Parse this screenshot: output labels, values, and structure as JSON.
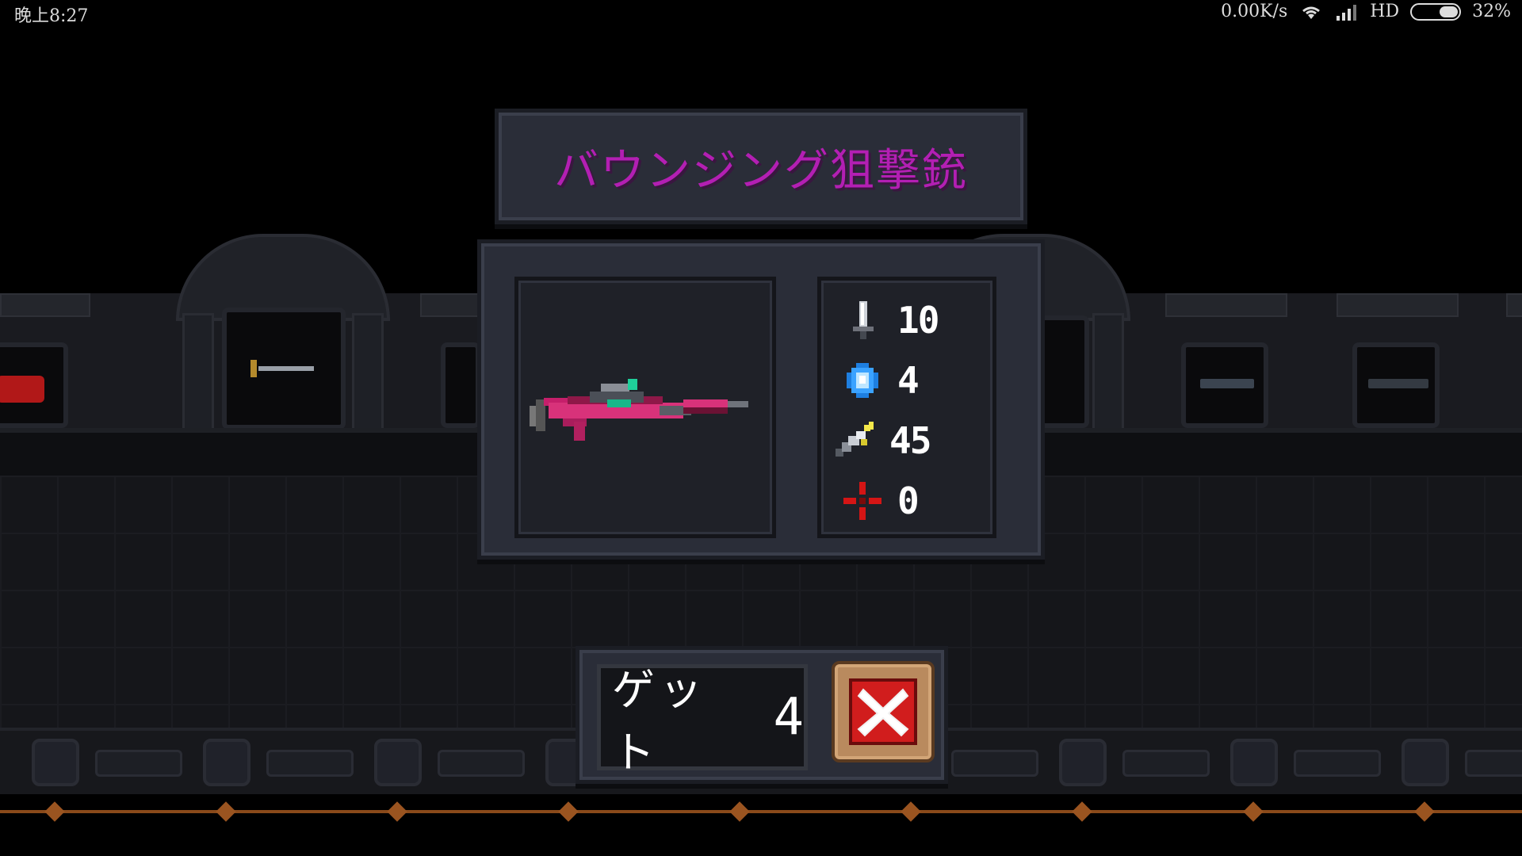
{
  "status_bar": {
    "time": "晚上8:27",
    "network_speed": "0.00K/s",
    "network_type": "HD",
    "battery": "32%"
  },
  "dialog": {
    "weapon_name": "バウンジング狙撃銃",
    "weapon_name_color": "#b31fb3",
    "stats": [
      {
        "icon": "sword-icon",
        "value": "10"
      },
      {
        "icon": "energy-crystal-icon",
        "value": "4"
      },
      {
        "icon": "critical-blade-icon",
        "value": "45"
      },
      {
        "icon": "crosshair-icon",
        "value": "0"
      }
    ],
    "get_label": "ゲット",
    "get_count": "4",
    "close_icon": "close-x-icon"
  },
  "colors": {
    "panel": "#2a2d38",
    "close_button": "#d11d1d",
    "button_frame": "#b98a5e"
  }
}
